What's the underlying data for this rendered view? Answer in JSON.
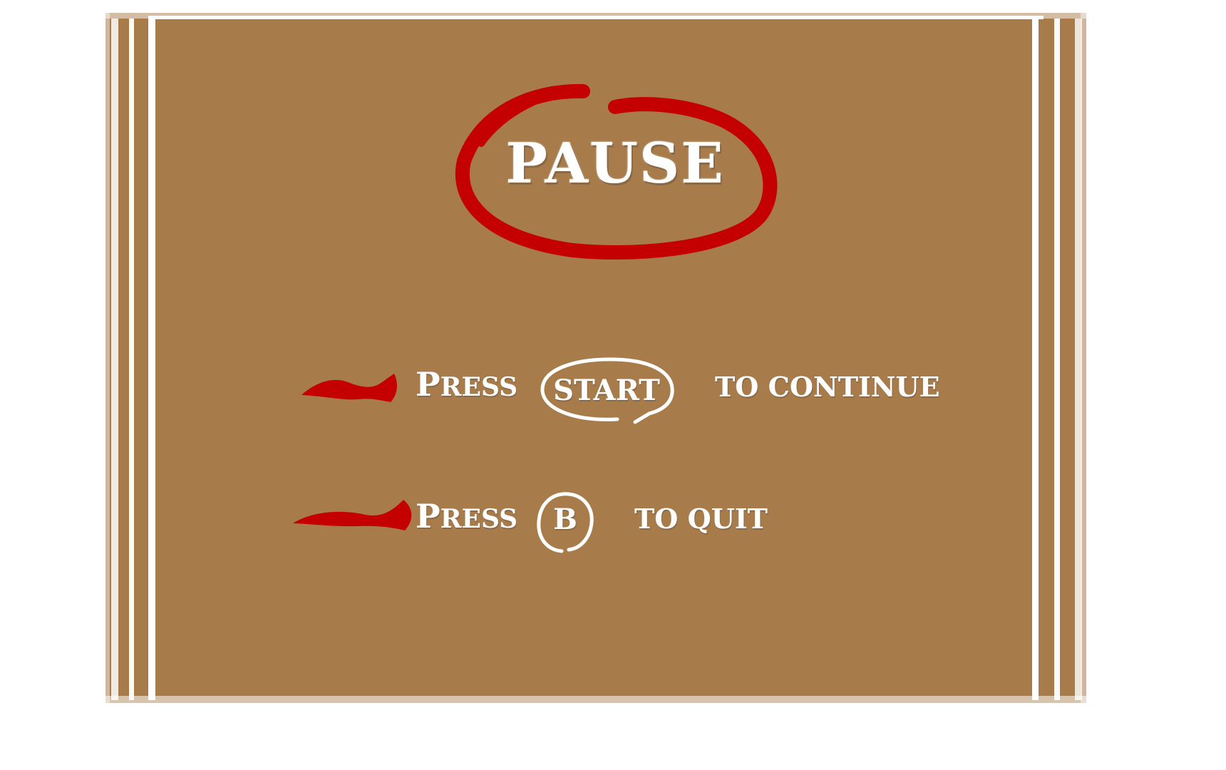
{
  "pause_menu": {
    "title": "PAUSE",
    "rows": [
      {
        "press_initial": "P",
        "press_rest": "RESS",
        "button_label": "START",
        "action_text": "TO CONTINUE"
      },
      {
        "press_initial": "P",
        "press_rest": "RESS",
        "button_label": "B",
        "action_text": "TO QUIT"
      }
    ]
  },
  "colors": {
    "panel": "#a87b4b",
    "accent_red": "#c40000",
    "text": "#ffffff"
  },
  "icons": [
    "red-brush-arrow-icon",
    "start-button-icon",
    "b-button-icon"
  ]
}
